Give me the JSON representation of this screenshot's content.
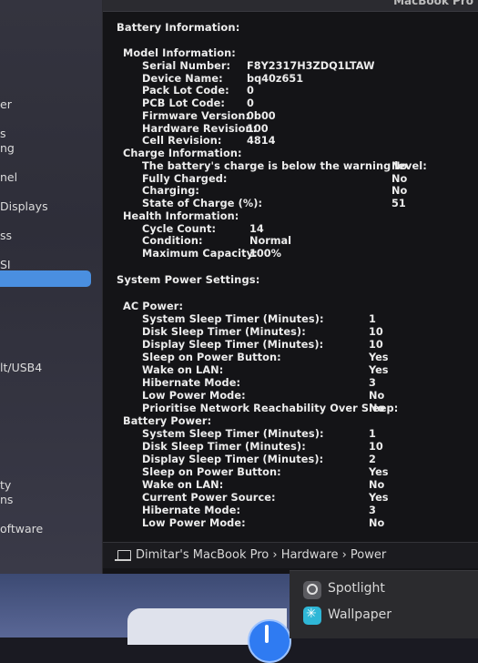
{
  "title_right": "MacBook Pro",
  "sidebar": {
    "items": [
      "er",
      "s",
      "ng",
      "nel",
      "Displays",
      "ss",
      "SI",
      "lt/USB4",
      "ty",
      "ns",
      "oftware"
    ]
  },
  "battery": {
    "heading": "Battery Information:",
    "model_heading": "Model Information:",
    "model": [
      {
        "label": "Serial Number:",
        "value": "F8Y2317H3ZDQ1LTAW"
      },
      {
        "label": "Device Name:",
        "value": "bq40z651"
      },
      {
        "label": "Pack Lot Code:",
        "value": "0"
      },
      {
        "label": "PCB Lot Code:",
        "value": "0"
      },
      {
        "label": "Firmware Version:",
        "value": "0b00"
      },
      {
        "label": "Hardware Revision:",
        "value": "100"
      },
      {
        "label": "Cell Revision:",
        "value": "4814"
      }
    ],
    "charge_heading": "Charge Information:",
    "charge": [
      {
        "label": "The battery's charge is below the warning level:",
        "value": "No"
      },
      {
        "label": "Fully Charged:",
        "value": "No"
      },
      {
        "label": "Charging:",
        "value": "No"
      },
      {
        "label": "State of Charge (%):",
        "value": "51"
      }
    ],
    "health_heading": "Health Information:",
    "health": [
      {
        "label": "Cycle Count:",
        "value": "14"
      },
      {
        "label": "Condition:",
        "value": "Normal"
      },
      {
        "label": "Maximum Capacity:",
        "value": "100%"
      }
    ]
  },
  "power": {
    "heading": "System Power Settings:",
    "ac_heading": "AC Power:",
    "ac": [
      {
        "label": "System Sleep Timer (Minutes):",
        "value": "1"
      },
      {
        "label": "Disk Sleep Timer (Minutes):",
        "value": "10"
      },
      {
        "label": "Display Sleep Timer (Minutes):",
        "value": "10"
      },
      {
        "label": "Sleep on Power Button:",
        "value": "Yes"
      },
      {
        "label": "Wake on LAN:",
        "value": "Yes"
      },
      {
        "label": "Hibernate Mode:",
        "value": "3"
      },
      {
        "label": "Low Power Mode:",
        "value": "No"
      },
      {
        "label": "Prioritise Network Reachability Over Sleep:",
        "value": "No"
      }
    ],
    "battery_heading": "Battery Power:",
    "battery": [
      {
        "label": "System Sleep Timer (Minutes):",
        "value": "1"
      },
      {
        "label": "Disk Sleep Timer (Minutes):",
        "value": "10"
      },
      {
        "label": "Display Sleep Timer (Minutes):",
        "value": "2"
      },
      {
        "label": "Sleep on Power Button:",
        "value": "Yes"
      },
      {
        "label": "Wake on LAN:",
        "value": "No"
      },
      {
        "label": "Current Power Source:",
        "value": "Yes"
      },
      {
        "label": "Hibernate Mode:",
        "value": "3"
      },
      {
        "label": "Low Power Mode:",
        "value": "No"
      }
    ]
  },
  "path": {
    "text": "Dimitar's MacBook Pro › Hardware › Power"
  },
  "dock": {
    "spotlight": "Spotlight",
    "wallpaper": "Wallpaper"
  }
}
